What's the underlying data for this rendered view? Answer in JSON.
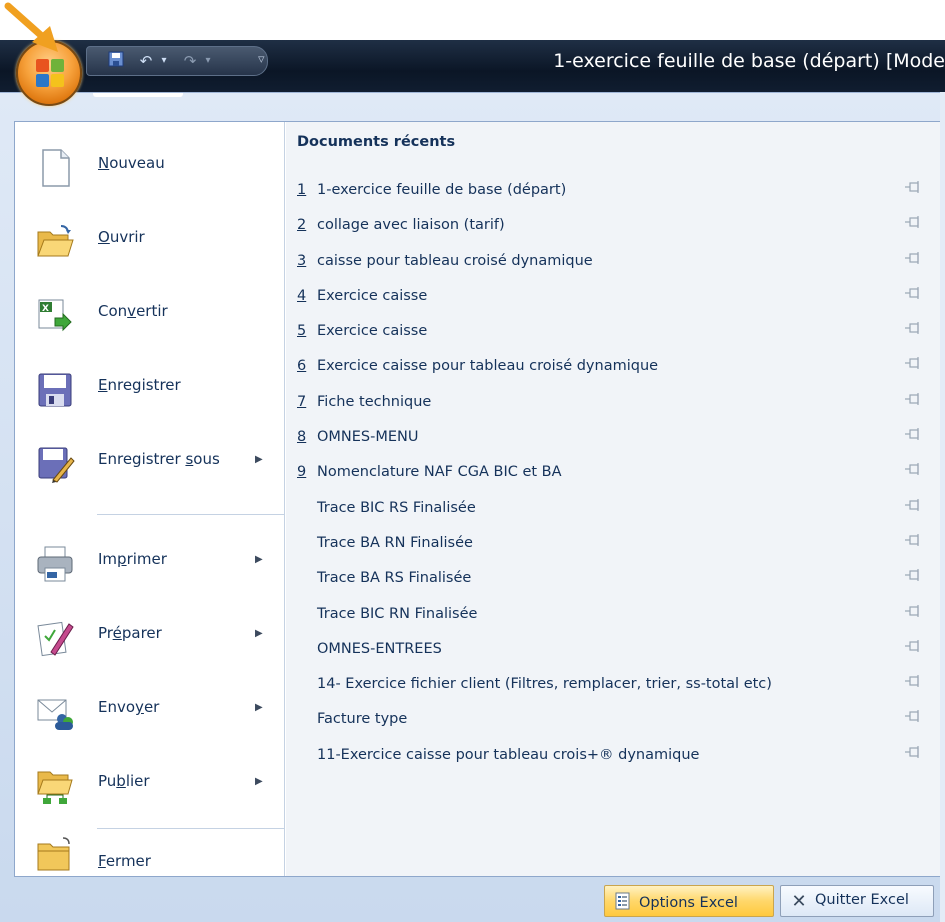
{
  "window": {
    "title": "1-exercice feuille de base (départ)  [Mode"
  },
  "quick_access": {
    "save_icon": "save-icon",
    "undo_icon": "undo-icon",
    "redo_icon": "redo-icon",
    "customize_icon": "customize-qat-icon"
  },
  "menu": {
    "items": [
      {
        "label": "Nouveau",
        "accel": "N",
        "icon": "new-document-icon",
        "submenu": false
      },
      {
        "label": "Ouvrir",
        "accel": "O",
        "icon": "open-folder-icon",
        "submenu": false
      },
      {
        "label": "Convertir",
        "accel": "v",
        "icon": "convert-icon",
        "submenu": false
      },
      {
        "label": "Enregistrer",
        "accel": "E",
        "icon": "save-disk-icon",
        "submenu": false
      },
      {
        "label": "Enregistrer sous",
        "accel": "s",
        "icon": "save-as-icon",
        "submenu": true
      },
      {
        "label": "Imprimer",
        "accel": "p",
        "icon": "printer-icon",
        "submenu": true
      },
      {
        "label": "Préparer",
        "accel": "é",
        "icon": "prepare-icon",
        "submenu": true
      },
      {
        "label": "Envoyer",
        "accel": "y",
        "icon": "send-icon",
        "submenu": true
      },
      {
        "label": "Publier",
        "accel": "b",
        "icon": "publish-icon",
        "submenu": true
      },
      {
        "label": "Fermer",
        "accel": "F",
        "icon": "close-folder-icon",
        "submenu": false
      }
    ]
  },
  "recent": {
    "title": "Documents récents",
    "items": [
      {
        "num": "1",
        "name": "1-exercice feuille de base (départ)"
      },
      {
        "num": "2",
        "name": "collage avec liaison (tarif)"
      },
      {
        "num": "3",
        "name": "caisse pour tableau croisé dynamique"
      },
      {
        "num": "4",
        "name": "Exercice caisse"
      },
      {
        "num": "5",
        "name": "Exercice caisse"
      },
      {
        "num": "6",
        "name": "Exercice caisse pour tableau croisé dynamique"
      },
      {
        "num": "7",
        "name": "Fiche technique"
      },
      {
        "num": "8",
        "name": "OMNES-MENU"
      },
      {
        "num": "9",
        "name": "Nomenclature NAF CGA BIC et BA"
      },
      {
        "num": "",
        "name": "Trace BIC RS Finalisée"
      },
      {
        "num": "",
        "name": "Trace BA RN Finalisée"
      },
      {
        "num": "",
        "name": "Trace BA RS Finalisée"
      },
      {
        "num": "",
        "name": "Trace BIC RN Finalisée"
      },
      {
        "num": "",
        "name": "OMNES-ENTREES"
      },
      {
        "num": "",
        "name": "14- Exercice fichier client (Filtres, remplacer, trier, ss-total etc)"
      },
      {
        "num": "",
        "name": "Facture type"
      },
      {
        "num": "",
        "name": "11-Exercice caisse pour tableau crois+® dynamique"
      }
    ]
  },
  "footer": {
    "options_label": "Options Excel",
    "quit_label": "Quitter Excel"
  },
  "colors": {
    "accent_orange": "#f7a23c",
    "menu_bg": "#dfe9f6",
    "text": "#15325a"
  }
}
